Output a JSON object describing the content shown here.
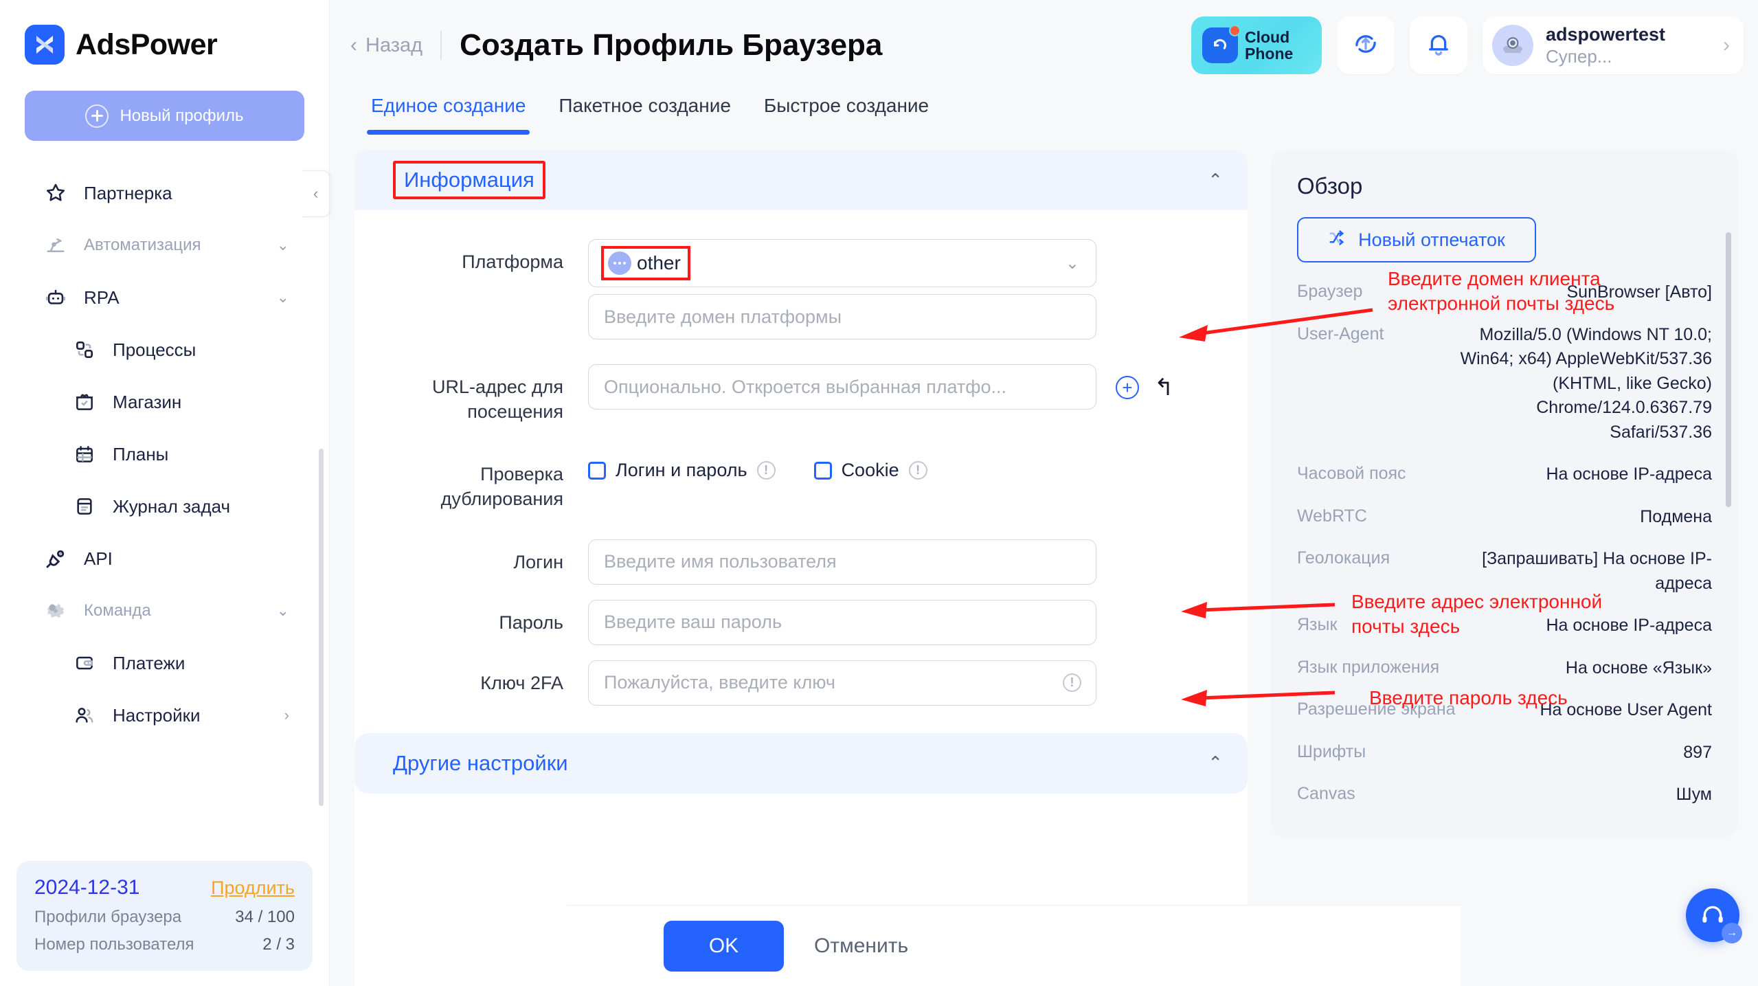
{
  "brand": {
    "name": "AdsPower",
    "logo_icon": "adspower-logo-icon"
  },
  "sidebar": {
    "new_profile_label": "Новый профиль",
    "items": [
      {
        "label": "Партнерка",
        "icon": "star-icon",
        "type": "item"
      },
      {
        "label": "Автоматизация",
        "icon": "automation-icon",
        "type": "group",
        "chevron": "⌄"
      },
      {
        "label": "RPA",
        "icon": "robot-icon",
        "type": "item",
        "chevron": "⌄"
      },
      {
        "label": "Процессы",
        "icon": "process-icon",
        "type": "sub"
      },
      {
        "label": "Магазин",
        "icon": "store-icon",
        "type": "sub"
      },
      {
        "label": "Планы",
        "icon": "calendar-icon",
        "type": "sub"
      },
      {
        "label": "Журнал задач",
        "icon": "log-icon",
        "type": "sub"
      },
      {
        "label": "API",
        "icon": "plug-icon",
        "type": "item"
      },
      {
        "label": "Команда",
        "icon": "gear-icon",
        "type": "group",
        "chevron": "⌄"
      },
      {
        "label": "Платежи",
        "icon": "wallet-icon",
        "type": "sub"
      },
      {
        "label": "Настройки",
        "icon": "users-icon",
        "type": "sub",
        "chevron": "›"
      }
    ],
    "subscription": {
      "date": "2024-12-31",
      "renew_label": "Продлить",
      "rows": [
        {
          "key": "Профили браузера",
          "value": "34 / 100"
        },
        {
          "key": "Номер пользователя",
          "value": "2 / 3"
        }
      ]
    }
  },
  "topbar": {
    "back_label": "Назад",
    "title": "Создать Профиль Браузера",
    "cloud_phone": {
      "line1": "Cloud",
      "line2": "Phone"
    },
    "sync_icon": "sync-upload-icon",
    "bell_icon": "bell-icon",
    "user": {
      "name": "adspowertest",
      "role": "Супер...",
      "chevron": "›"
    }
  },
  "tabs": [
    {
      "label": "Единое создание",
      "active": true
    },
    {
      "label": "Пакетное создание",
      "active": false
    },
    {
      "label": "Быстрое создание",
      "active": false
    }
  ],
  "form": {
    "section_title": "Информация",
    "platform": {
      "label": "Платформа",
      "value": "other",
      "domain_placeholder": "Введите домен платформы"
    },
    "url": {
      "label": "URL-адрес для посещения",
      "placeholder": "Опционально. Откроется выбранная платфо..."
    },
    "dup_check": {
      "label": "Проверка дублирования",
      "options": [
        {
          "label": "Логин и пароль",
          "checked": false
        },
        {
          "label": "Cookie",
          "checked": false
        }
      ]
    },
    "login": {
      "label": "Логин",
      "placeholder": "Введите имя пользователя"
    },
    "password": {
      "label": "Пароль",
      "placeholder": "Введите ваш пароль"
    },
    "twofa": {
      "label": "Ключ 2FA",
      "placeholder": "Пожалуйста, введите ключ"
    },
    "other_settings_title": "Другие настройки"
  },
  "overview": {
    "title": "Обзор",
    "new_fingerprint_label": "Новый отпечаток",
    "rows": [
      {
        "key": "Браузер",
        "value": "SunBrowser [Авто]"
      },
      {
        "key": "User-Agent",
        "value": "Mozilla/5.0 (Windows NT 10.0; Win64; x64) AppleWebKit/537.36 (KHTML, like Gecko) Chrome/124.0.6367.79 Safari/537.36"
      },
      {
        "key": "Часовой пояс",
        "value": "На основе IP-адреса"
      },
      {
        "key": "WebRTC",
        "value": "Подмена"
      },
      {
        "key": "Геолокация",
        "value": "[Запрашивать] На основе IP-адреса"
      },
      {
        "key": "Язык",
        "value": "На основе IP-адреса"
      },
      {
        "key": "Язык приложения",
        "value": "На основе «Язык»"
      },
      {
        "key": "Разрешение экрана",
        "value": "На основе User Agent"
      },
      {
        "key": "Шрифты",
        "value": "897"
      },
      {
        "key": "Canvas",
        "value": "Шум"
      }
    ]
  },
  "annotations": [
    {
      "text": "Введите домен клиента\nэлектронной почты здесь"
    },
    {
      "text": "Введите адрес электронной\nпочты здесь"
    },
    {
      "text": "Введите пароль здесь"
    }
  ],
  "footer": {
    "ok_label": "OK",
    "cancel_label": "Отменить"
  },
  "colors": {
    "accent": "#2563ff",
    "annotation": "#ff1a1a",
    "renew": "#f5a524"
  }
}
